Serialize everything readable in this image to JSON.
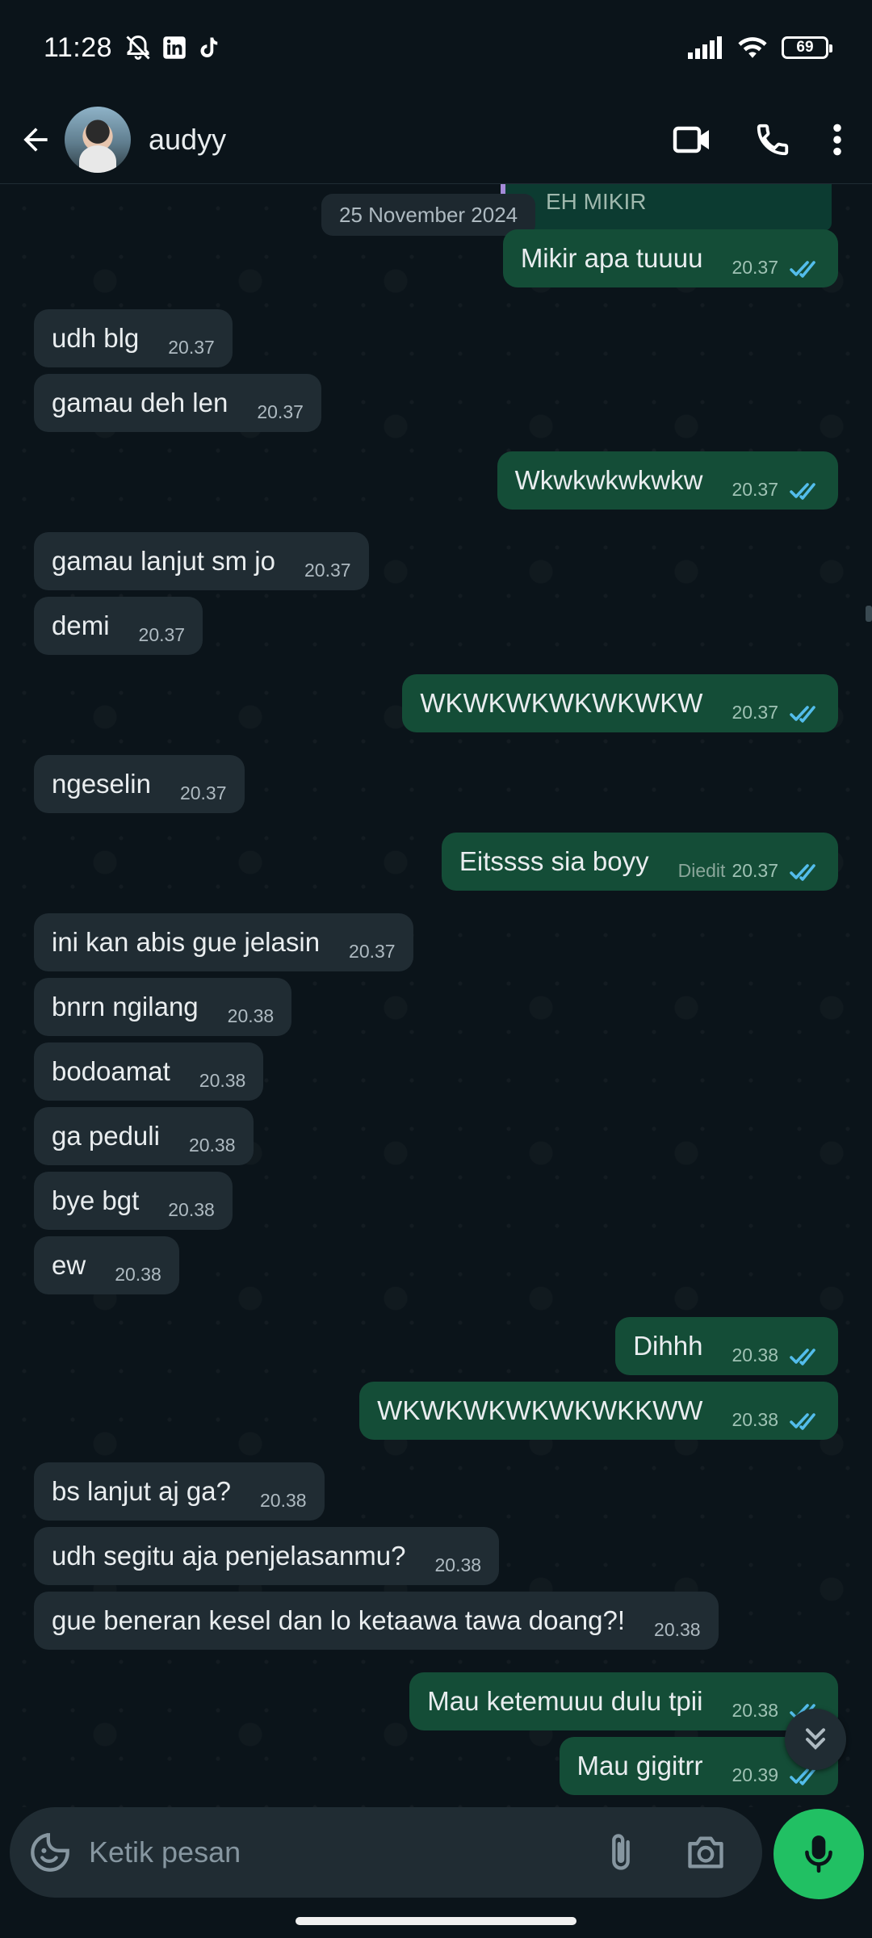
{
  "status_bar": {
    "time": "11:28",
    "battery": "69"
  },
  "header": {
    "contact_name": "audyy"
  },
  "chat": {
    "date_chip": "25 November 2024",
    "quoted_fragment": "EH MIKIR",
    "messages": [
      {
        "dir": "out",
        "text": "Mikir apa tuuuu",
        "time": "20.37",
        "edited": ""
      },
      {
        "dir": "in",
        "text": "udh blg",
        "time": "20.37",
        "edited": ""
      },
      {
        "dir": "in",
        "text": "gamau deh len",
        "time": "20.37",
        "edited": ""
      },
      {
        "dir": "out",
        "text": "Wkwkwkwkwkw",
        "time": "20.37",
        "edited": ""
      },
      {
        "dir": "in",
        "text": "gamau lanjut sm jo",
        "time": "20.37",
        "edited": ""
      },
      {
        "dir": "in",
        "text": "demi",
        "time": "20.37",
        "edited": ""
      },
      {
        "dir": "out",
        "text": "WKWKWKWKWKWKW",
        "time": "20.37",
        "edited": ""
      },
      {
        "dir": "in",
        "text": "ngeselin",
        "time": "20.37",
        "edited": ""
      },
      {
        "dir": "out",
        "text": "Eitssss sia boyy",
        "time": "20.37",
        "edited": "Diedit"
      },
      {
        "dir": "in",
        "text": "ini kan abis gue jelasin",
        "time": "20.37",
        "edited": ""
      },
      {
        "dir": "in",
        "text": "bnrn ngilang",
        "time": "20.38",
        "edited": ""
      },
      {
        "dir": "in",
        "text": "bodoamat",
        "time": "20.38",
        "edited": ""
      },
      {
        "dir": "in",
        "text": "ga peduli",
        "time": "20.38",
        "edited": ""
      },
      {
        "dir": "in",
        "text": "bye bgt",
        "time": "20.38",
        "edited": ""
      },
      {
        "dir": "in",
        "text": "ew",
        "time": "20.38",
        "edited": ""
      },
      {
        "dir": "out",
        "text": "Dihhh",
        "time": "20.38",
        "edited": ""
      },
      {
        "dir": "out",
        "text": "WKWKWKWKWKWKKWW",
        "time": "20.38",
        "edited": ""
      },
      {
        "dir": "in",
        "text": "bs lanjut aj ga?",
        "time": "20.38",
        "edited": ""
      },
      {
        "dir": "in",
        "text": "udh segitu aja penjelasanmu?",
        "time": "20.38",
        "edited": ""
      },
      {
        "dir": "in",
        "text": "gue beneran kesel dan lo ketaawa tawa doang?!",
        "time": "20.38",
        "edited": ""
      },
      {
        "dir": "out",
        "text": "Mau ketemuuu dulu tpii",
        "time": "20.38",
        "edited": ""
      },
      {
        "dir": "out",
        "text": "Mau gigitrr",
        "time": "20.39",
        "edited": ""
      }
    ]
  },
  "composer": {
    "placeholder": "Ketik pesan"
  },
  "colors": {
    "incoming": "#202c33",
    "outgoing": "#144d37",
    "read_ticks": "#53bdeb",
    "mic": "#21c063"
  }
}
